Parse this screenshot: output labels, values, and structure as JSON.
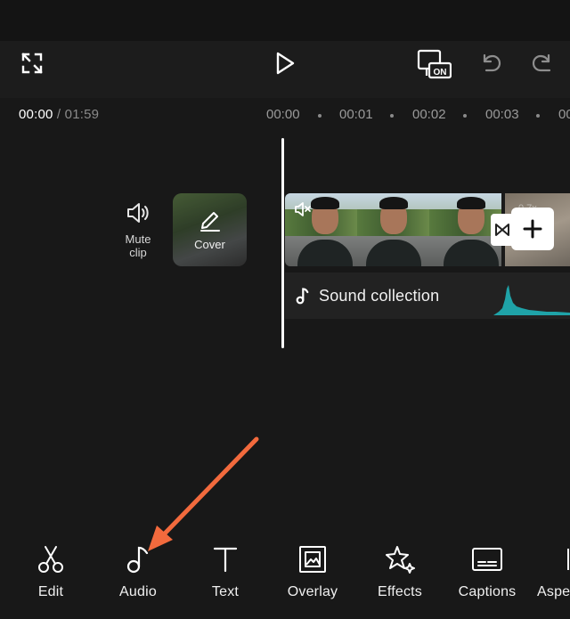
{
  "header": {
    "icons": [
      "fullscreen-icon",
      "play-icon",
      "hd-on-icon",
      "undo-icon",
      "redo-icon"
    ],
    "hd_badge": "ON"
  },
  "timeline": {
    "current_time": "00:00",
    "separator": "/",
    "duration": "01:59",
    "ruler": [
      "00:00",
      "00:01",
      "00:02",
      "00:03",
      "00"
    ]
  },
  "track_controls": {
    "mute_label_line1": "Mute",
    "mute_label_line2": "clip",
    "cover_label": "Cover"
  },
  "video_track": {
    "speed_badge": "0.7x"
  },
  "audio_track": {
    "label": "Sound collection",
    "wave_color": "#1fa3a8"
  },
  "toolbar": {
    "items": [
      {
        "label": "Edit",
        "icon": "scissors-icon"
      },
      {
        "label": "Audio",
        "icon": "music-note-icon"
      },
      {
        "label": "Text",
        "icon": "text-icon"
      },
      {
        "label": "Overlay",
        "icon": "overlay-icon"
      },
      {
        "label": "Effects",
        "icon": "effects-star-icon"
      },
      {
        "label": "Captions",
        "icon": "captions-icon"
      },
      {
        "label": "Aspe",
        "icon": "aspect-icon"
      }
    ]
  },
  "annotation": {
    "arrow_color": "#f26a3d"
  }
}
